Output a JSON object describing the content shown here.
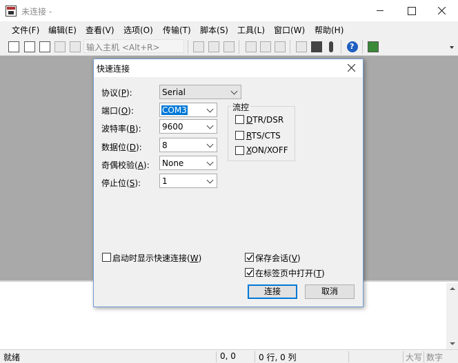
{
  "window": {
    "title": "未连接 -"
  },
  "menu": [
    {
      "label": "文件(F)"
    },
    {
      "label": "编辑(E)"
    },
    {
      "label": "查看(V)"
    },
    {
      "label": "选项(O)"
    },
    {
      "label": "传输(T)"
    },
    {
      "label": "脚本(S)"
    },
    {
      "label": "工具(L)"
    },
    {
      "label": "窗口(W)"
    },
    {
      "label": "帮助(H)"
    }
  ],
  "toolbar": {
    "host_placeholder": "输入主机 <Alt+R>"
  },
  "dialog": {
    "title": "快速连接",
    "protocol": {
      "label": "协议(",
      "key": "P",
      "tail": "):",
      "value": "Serial"
    },
    "port": {
      "label": "端口(",
      "key": "O",
      "tail": "):",
      "value": "COM3"
    },
    "baud": {
      "label": "波特率(",
      "key": "B",
      "tail": "):",
      "value": "9600"
    },
    "databits": {
      "label": "数据位(",
      "key": "D",
      "tail": "):",
      "value": "8"
    },
    "parity": {
      "label": "奇偶校验(",
      "key": "A",
      "tail": "):",
      "value": "None"
    },
    "stopbits": {
      "label": "停止位(",
      "key": "S",
      "tail": "):",
      "value": "1"
    },
    "flow": {
      "title": "流控",
      "dtr": {
        "key": "D",
        "rest": "TR/DSR",
        "checked": false
      },
      "rts": {
        "key": "R",
        "rest": "TS/CTS",
        "checked": false
      },
      "xon": {
        "key": "X",
        "rest": "ON/XOFF",
        "checked": false
      }
    },
    "show_on_startup": {
      "label": "启动时显示快速连接(",
      "key": "W",
      "tail": ")",
      "checked": false
    },
    "save_session": {
      "label": "保存会话(",
      "key": "V",
      "tail": ")",
      "checked": true
    },
    "open_in_tab": {
      "label": "在标签页中打开(",
      "key": "T",
      "tail": ")",
      "checked": true
    },
    "connect_label": "连接",
    "cancel_label": "取消"
  },
  "status": {
    "ready": "就绪",
    "position": "0, 0",
    "rowcol": "0 行, 0 列",
    "caps": "大写",
    "num": "数字"
  }
}
